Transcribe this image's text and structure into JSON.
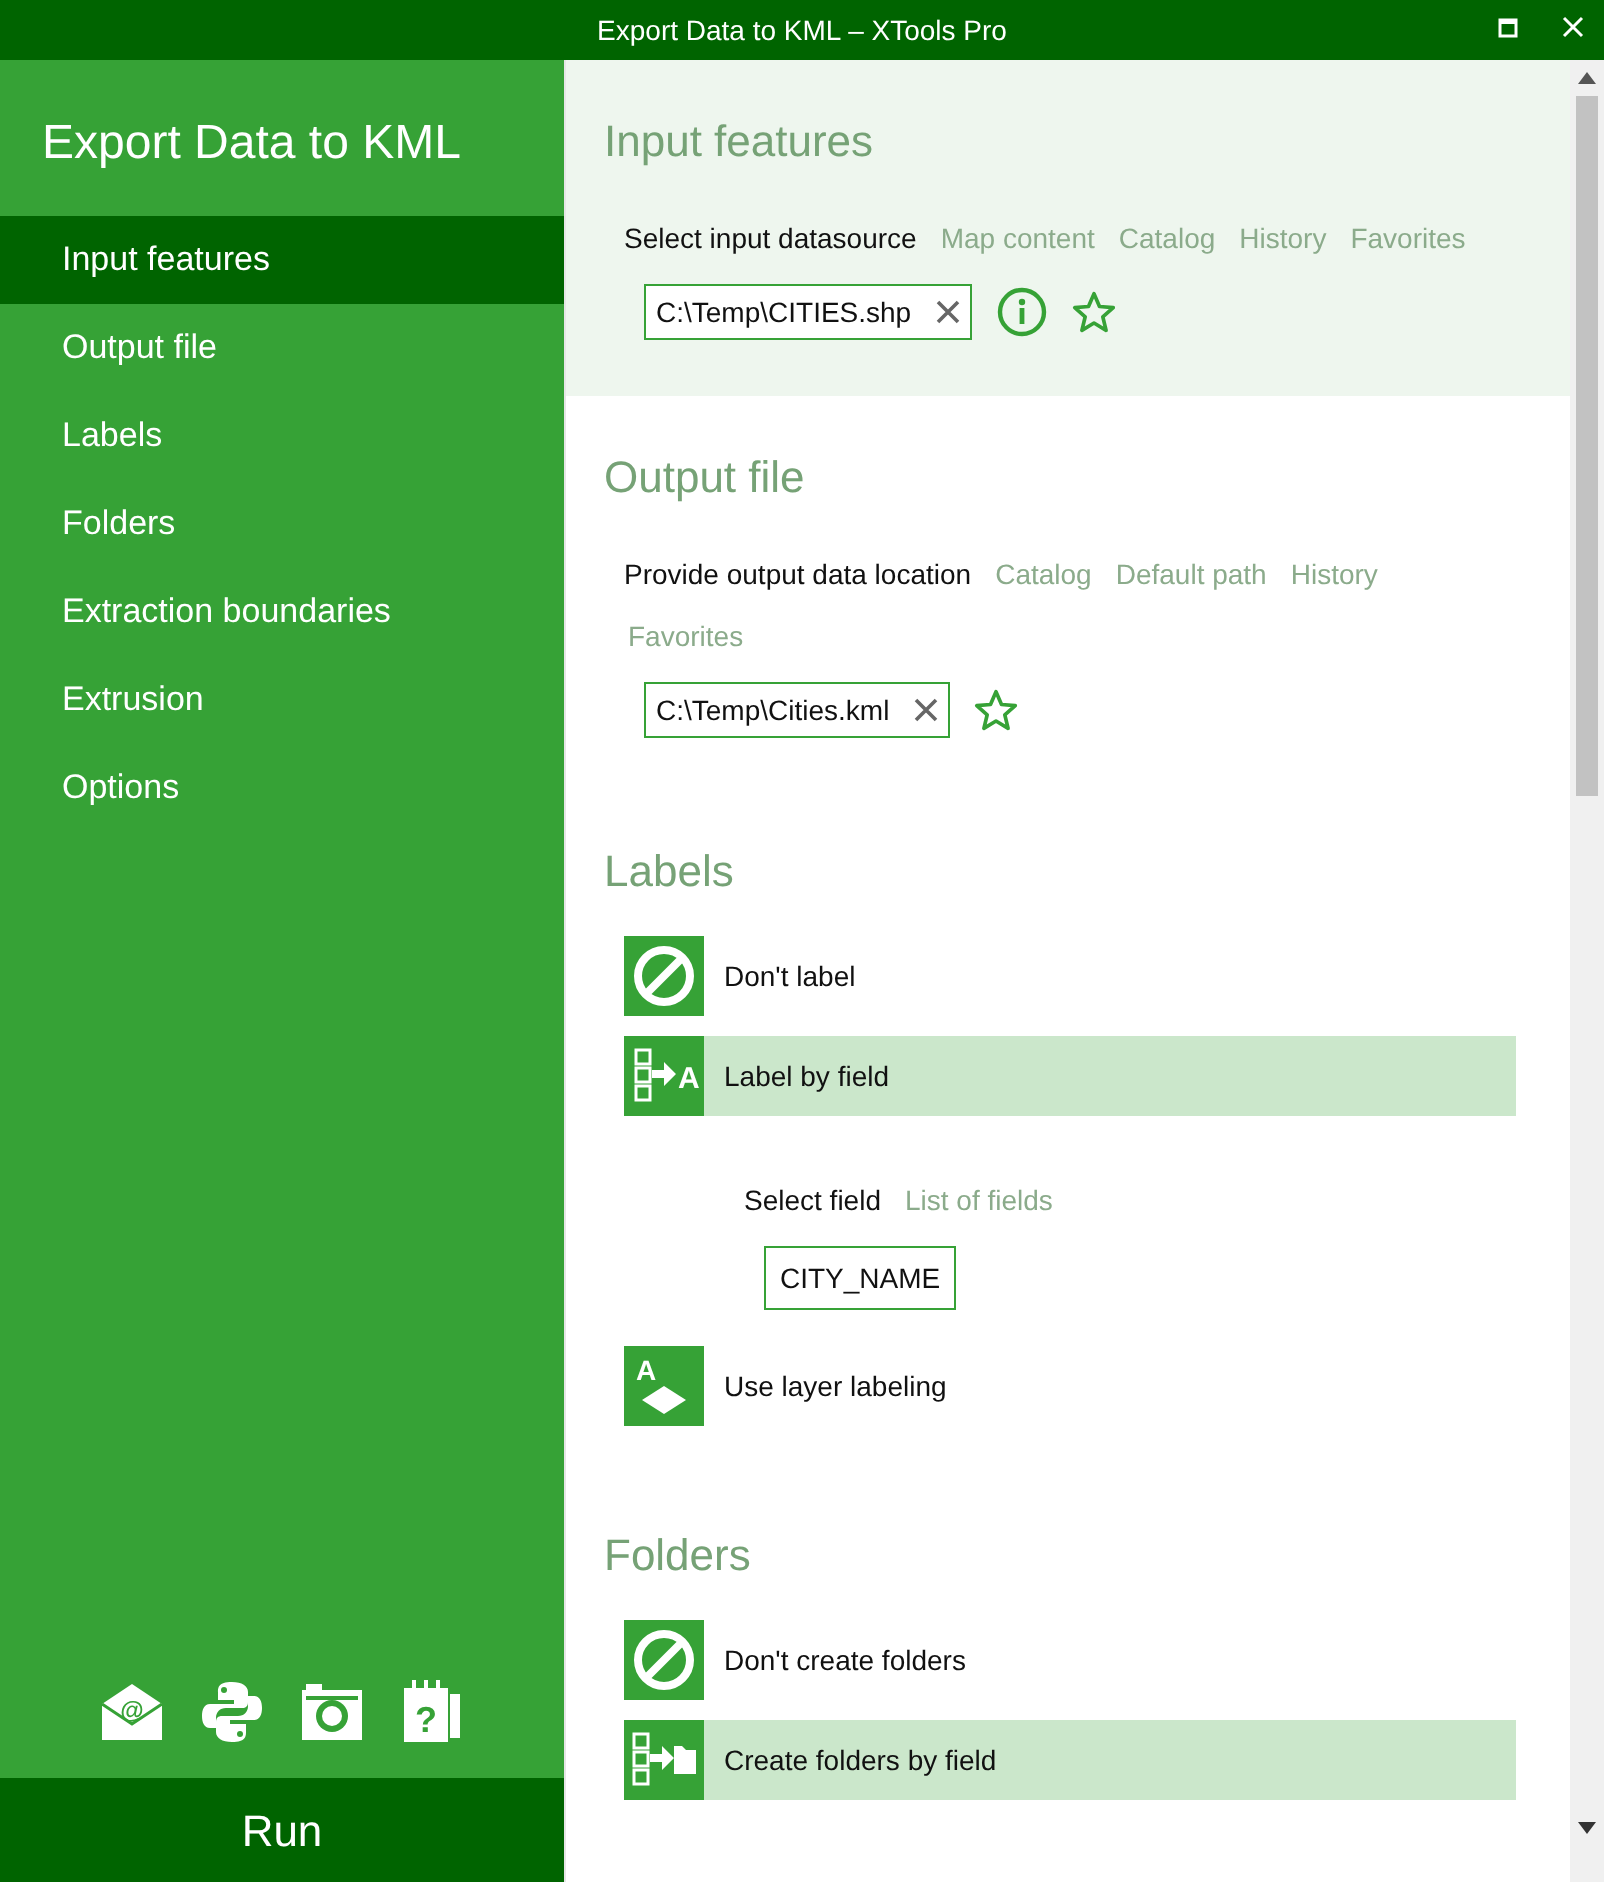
{
  "window": {
    "title": "Export Data to KML – XTools Pro"
  },
  "sidebar": {
    "title": "Export Data to KML",
    "items": [
      {
        "label": "Input features",
        "selected": true
      },
      {
        "label": "Output file",
        "selected": false
      },
      {
        "label": "Labels",
        "selected": false
      },
      {
        "label": "Folders",
        "selected": false
      },
      {
        "label": "Extraction boundaries",
        "selected": false
      },
      {
        "label": "Extrusion",
        "selected": false
      },
      {
        "label": "Options",
        "selected": false
      }
    ],
    "tools": [
      {
        "kind": "email",
        "glyph": "@"
      },
      {
        "kind": "python"
      },
      {
        "kind": "camera"
      },
      {
        "kind": "help",
        "glyph": "?"
      }
    ],
    "run_button": "Run"
  },
  "sections": [
    {
      "kind": "source",
      "title": "Input features",
      "active": true,
      "prompt": "Select input datasource",
      "links": [
        "Map content",
        "Catalog",
        "History",
        "Favorites"
      ],
      "path": "C:\\Temp\\CITIES.shp",
      "info": true
    },
    {
      "kind": "source",
      "title": "Output file",
      "active": false,
      "prompt": "Provide output data location",
      "links": [
        "Catalog",
        "Default path",
        "History",
        "Favorites"
      ],
      "path": "C:\\Temp\\Cities.kml",
      "info": false
    },
    {
      "kind": "choice",
      "title": "Labels",
      "active": false,
      "options": [
        {
          "kind": "none",
          "label": "Don't label",
          "selected": false
        },
        {
          "kind": "field",
          "label": "Label by field",
          "selected": true,
          "icon_letter": "A",
          "sub": {
            "prompt": "Select field",
            "links": [
              "List of fields"
            ],
            "value": "CITY_NAME"
          }
        },
        {
          "kind": "layer",
          "label": "Use layer labeling",
          "selected": false,
          "icon_letter": "A"
        }
      ]
    },
    {
      "kind": "choice",
      "title": "Folders",
      "active": false,
      "options": [
        {
          "kind": "none",
          "label": "Don't create folders",
          "selected": false
        },
        {
          "kind": "folder",
          "label": "Create folders by field",
          "selected": true
        }
      ]
    }
  ]
}
